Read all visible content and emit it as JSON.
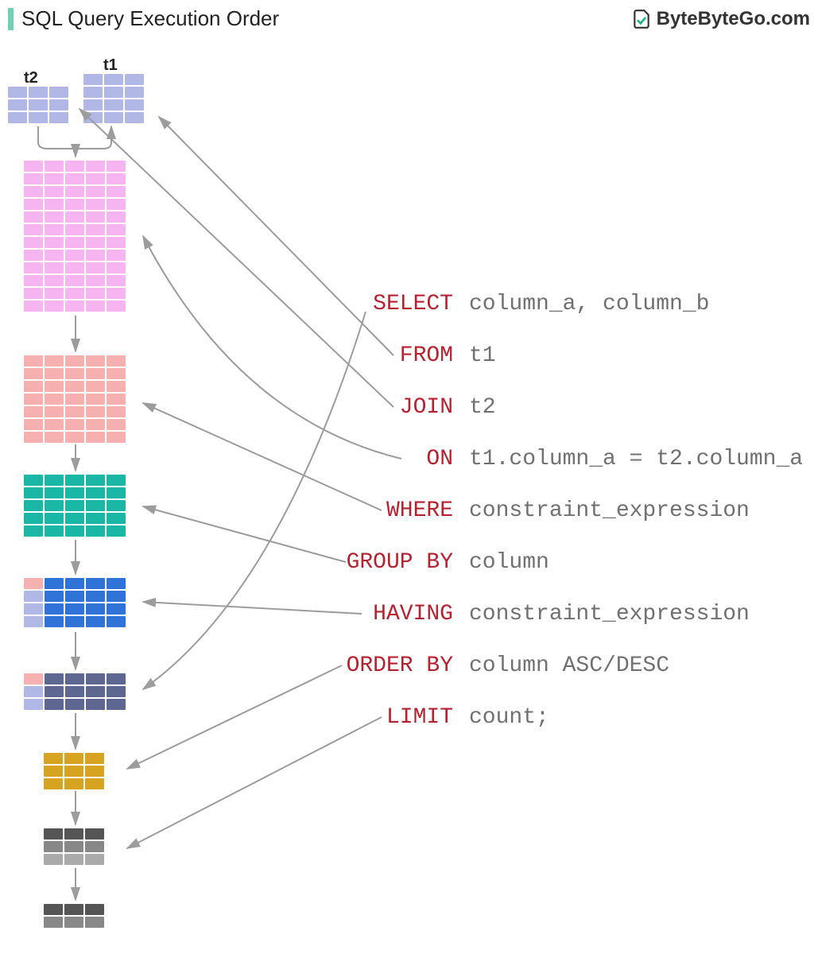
{
  "header": {
    "title": "SQL Query Execution Order",
    "brand": "ByteByteGo.com"
  },
  "table_labels": {
    "t1": "t1",
    "t2": "t2"
  },
  "sql": {
    "select": {
      "kw": "SELECT",
      "arg": "column_a, column_b"
    },
    "from": {
      "kw": "FROM",
      "arg": "t1"
    },
    "join": {
      "kw": "JOIN",
      "arg": "t2"
    },
    "on": {
      "kw": "ON",
      "arg": "t1.column_a = t2.column_a"
    },
    "where": {
      "kw": "WHERE",
      "arg": "constraint_expression"
    },
    "groupby": {
      "kw": "GROUP BY",
      "arg": "column"
    },
    "having": {
      "kw": "HAVING",
      "arg": "constraint_expression"
    },
    "orderby": {
      "kw": "ORDER BY",
      "arg": "column ASC/DESC"
    },
    "limit": {
      "kw": "LIMIT",
      "arg": "count;"
    }
  },
  "grids": {
    "t2": {
      "rows": 3,
      "cols": 3,
      "color": "#b2b8e6"
    },
    "t1": {
      "rows": 4,
      "cols": 3,
      "color": "#b2b8e6"
    },
    "join": {
      "rows": 12,
      "cols": 5,
      "color": "#f6b5f0"
    },
    "where": {
      "rows": 7,
      "cols": 5,
      "color": "#f6b0b0"
    },
    "groupg": {
      "rows": 5,
      "cols": 5,
      "color": "#1ab6a6"
    },
    "having": {
      "rows": 4,
      "cols": 5,
      "mix": [
        [
          "#f6b0b0",
          "#2f73d8",
          "#2f73d8",
          "#2f73d8",
          "#2f73d8"
        ],
        [
          "#b2b8e6",
          "#2f73d8",
          "#2f73d8",
          "#2f73d8",
          "#2f73d8"
        ],
        [
          "#b2b8e6",
          "#2f73d8",
          "#2f73d8",
          "#2f73d8",
          "#2f73d8"
        ],
        [
          "#b2b8e6",
          "#2f73d8",
          "#2f73d8",
          "#2f73d8",
          "#2f73d8"
        ]
      ]
    },
    "select": {
      "rows": 3,
      "cols": 5,
      "mix": [
        [
          "#f6b0b0",
          "#5d678f",
          "#5d678f",
          "#5d678f",
          "#5d678f"
        ],
        [
          "#b2b8e6",
          "#5d678f",
          "#5d678f",
          "#5d678f",
          "#5d678f"
        ],
        [
          "#b2b8e6",
          "#5d678f",
          "#5d678f",
          "#5d678f",
          "#5d678f"
        ]
      ]
    },
    "orderby": {
      "rows": 3,
      "cols": 3,
      "color": "#d6a420"
    },
    "limit": {
      "rows": 3,
      "cols": 3,
      "mix": [
        [
          "#555",
          "#555",
          "#555"
        ],
        [
          "#888",
          "#888",
          "#888"
        ],
        [
          "#aaa",
          "#aaa",
          "#aaa"
        ]
      ]
    },
    "final": {
      "rows": 2,
      "cols": 3,
      "mix": [
        [
          "#555",
          "#555",
          "#555"
        ],
        [
          "#888",
          "#888",
          "#888"
        ]
      ]
    }
  }
}
